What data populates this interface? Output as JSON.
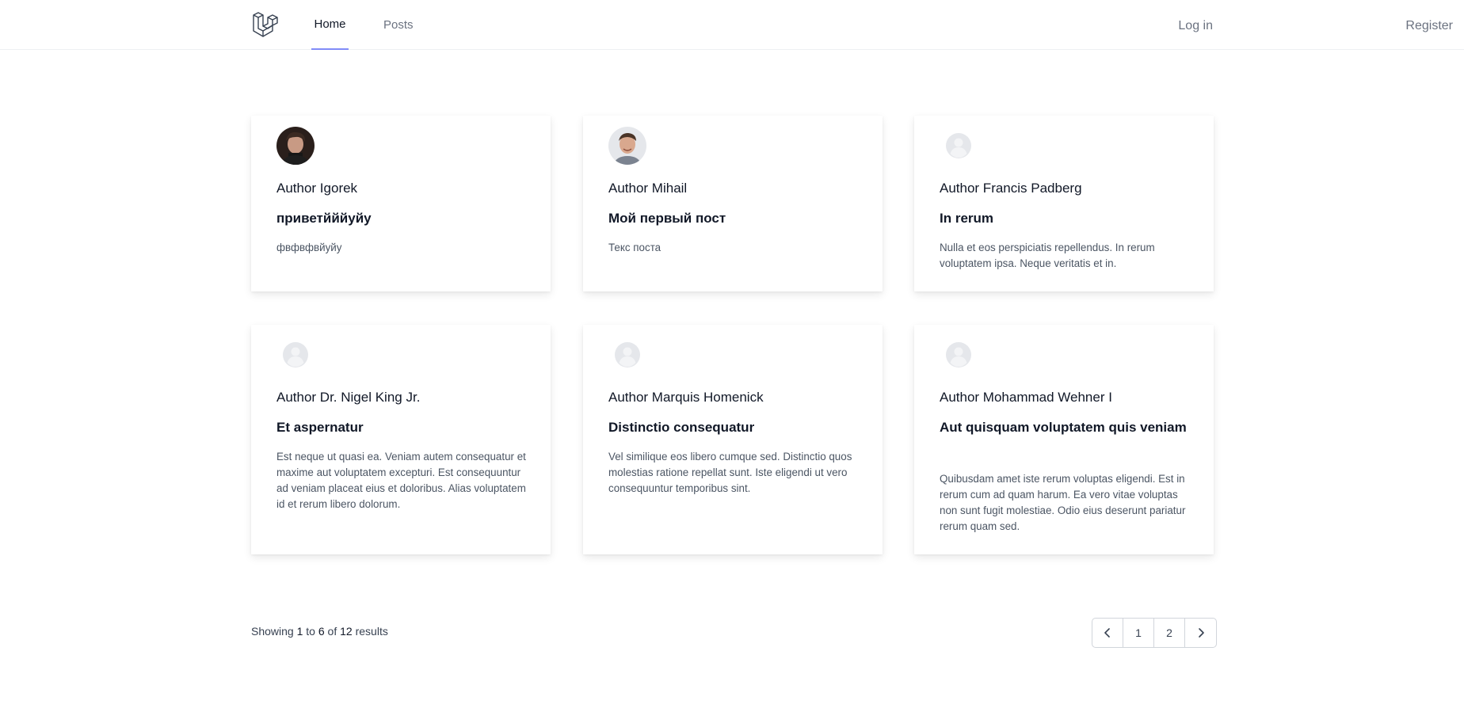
{
  "nav": {
    "home_label": "Home",
    "posts_label": "Posts",
    "login_label": "Log in",
    "register_label": "Register",
    "accent_color": "#818cf8"
  },
  "cards": [
    {
      "author": "Author Igorek",
      "title": "приветйййуйу",
      "body": "фвфвфвйуйу",
      "avatar": "photo-dark-hair"
    },
    {
      "author": "Author Mihail",
      "title": "Мой первый пост",
      "body": "Текс поста",
      "avatar": "photo-smiling-man"
    },
    {
      "author": "Author Francis Padberg",
      "title": "In rerum",
      "body": "Nulla et eos perspiciatis repellendus. In rerum voluptatem ipsa. Neque veritatis et in.",
      "avatar": "default-user-icon"
    },
    {
      "author": "Author Dr. Nigel King Jr.",
      "title": "Et aspernatur",
      "body": "Est neque ut quasi ea. Veniam autem consequatur et maxime aut voluptatem excepturi. Est consequuntur ad veniam placeat eius et doloribus. Alias voluptatem id et rerum libero dolorum.",
      "avatar": "default-user-icon"
    },
    {
      "author": "Author Marquis Homenick",
      "title": "Distinctio consequatur",
      "body": "Vel similique eos libero cumque sed. Distinctio quos molestias ratione repellat sunt. Iste eligendi ut vero consequuntur temporibus sint.",
      "avatar": "default-user-icon"
    },
    {
      "author": "Author Mohammad Wehner I",
      "title": "Aut quisquam voluptatem quis veniam",
      "body": "Quibusdam amet iste rerum voluptas eligendi. Est in rerum cum ad quam harum. Ea vero vitae voluptas non sunt fugit molestiae. Odio eius deserunt pariatur rerum quam sed.",
      "avatar": "default-user-icon"
    }
  ],
  "pagination": {
    "showing_label": "Showing",
    "from": "1",
    "to_label": "to",
    "to": "6",
    "of_label": "of",
    "total": "12",
    "results_label": "results",
    "pages": [
      "1",
      "2"
    ]
  }
}
